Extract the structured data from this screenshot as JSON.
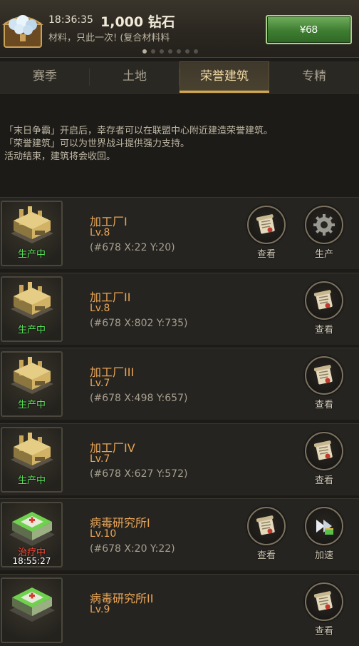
{
  "banner": {
    "time": "18:36:35",
    "amount": "1,000 钻石",
    "desc": "材料，只此一次! (复合材料料",
    "price": "¥68",
    "page_count": 7,
    "active_page": 0
  },
  "tabs": [
    {
      "label": "赛季",
      "active": false
    },
    {
      "label": "土地",
      "active": false
    },
    {
      "label": "荣誉建筑",
      "active": true
    },
    {
      "label": "专精",
      "active": false
    }
  ],
  "description": {
    "line1": "「末日争霸」开启后，幸存者可以在联盟中心附近建造荣誉建筑。",
    "line2": "「荣誉建筑」可以为世界战斗提供强力支持。",
    "line3": "活动结束，建筑将会收回。"
  },
  "buildings": [
    {
      "name": "加工厂I",
      "level": "Lv.8",
      "coords": "(#678 X:22 Y:20)",
      "kind": "factory",
      "status": "生产中",
      "timer": "",
      "actions": [
        {
          "label": "查看",
          "icon": "scroll-icon"
        },
        {
          "label": "生产",
          "icon": "gear-icon"
        }
      ]
    },
    {
      "name": "加工厂II",
      "level": "Lv.8",
      "coords": "(#678 X:802 Y:735)",
      "kind": "factory",
      "status": "生产中",
      "timer": "",
      "actions": [
        {
          "label": "查看",
          "icon": "scroll-icon"
        }
      ]
    },
    {
      "name": "加工厂III",
      "level": "Lv.7",
      "coords": "(#678 X:498 Y:657)",
      "kind": "factory",
      "status": "生产中",
      "timer": "",
      "actions": [
        {
          "label": "查看",
          "icon": "scroll-icon"
        }
      ]
    },
    {
      "name": "加工厂IV",
      "level": "Lv.7",
      "coords": "(#678 X:627 Y:572)",
      "kind": "factory",
      "status": "生产中",
      "timer": "",
      "actions": [
        {
          "label": "查看",
          "icon": "scroll-icon"
        }
      ]
    },
    {
      "name": "病毒研究所I",
      "level": "Lv.10",
      "coords": "(#678 X:20 Y:22)",
      "kind": "lab",
      "status": "治疗中",
      "timer": "18:55:27",
      "actions": [
        {
          "label": "查看",
          "icon": "scroll-icon"
        },
        {
          "label": "加速",
          "icon": "fast-forward-icon"
        }
      ]
    },
    {
      "name": "病毒研究所II",
      "level": "Lv.9",
      "coords": "",
      "kind": "lab",
      "status": "",
      "timer": "",
      "actions": [
        {
          "label": "查看",
          "icon": "scroll-icon"
        }
      ]
    }
  ],
  "colors": {
    "accent_gold": "#d4a84e",
    "name_orange": "#e9a556",
    "status_green": "#58e05a",
    "status_red": "#ff4b3a",
    "buy_green": "#3e7d31"
  }
}
